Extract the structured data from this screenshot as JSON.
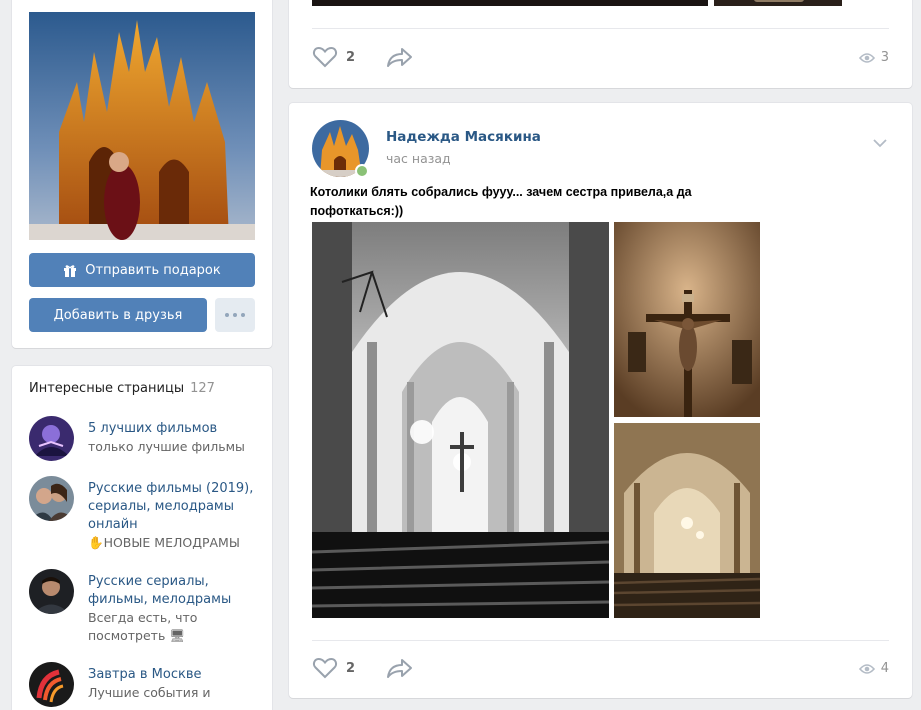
{
  "profile": {
    "gift_button": "Отправить подарок",
    "add_friend_button": "Добавить в друзья",
    "more_icon": "ellipsis-icon",
    "gift_icon": "gift-icon"
  },
  "interests": {
    "title": "Интересные страницы",
    "count": "127",
    "items": [
      {
        "title": "5 лучших фильмов",
        "subtitle": "только лучшие фильмы"
      },
      {
        "title": "Русские фильмы (2019), сериалы, мелодрамы онлайн",
        "subtitle": "✋НОВЫЕ МЕЛОДРАМЫ"
      },
      {
        "title": "Русские сериалы, фильмы, мелодрамы",
        "subtitle": "Всегда есть, что посмотреть 🖥"
      },
      {
        "title": "Завтра в Москве",
        "subtitle": "Лучшие события и"
      }
    ]
  },
  "post_top": {
    "likes": "2",
    "views": "3"
  },
  "post": {
    "author": "Надежда Масякина",
    "time": "час назад",
    "text": "Котолики блять собрались фууу... зачем сестра привела,а да пофоткаться:))",
    "likes": "2",
    "views": "4"
  },
  "colors": {
    "link": "#2a5885",
    "button": "#5181b8",
    "background": "#edeef0",
    "online": "#8ac176"
  }
}
